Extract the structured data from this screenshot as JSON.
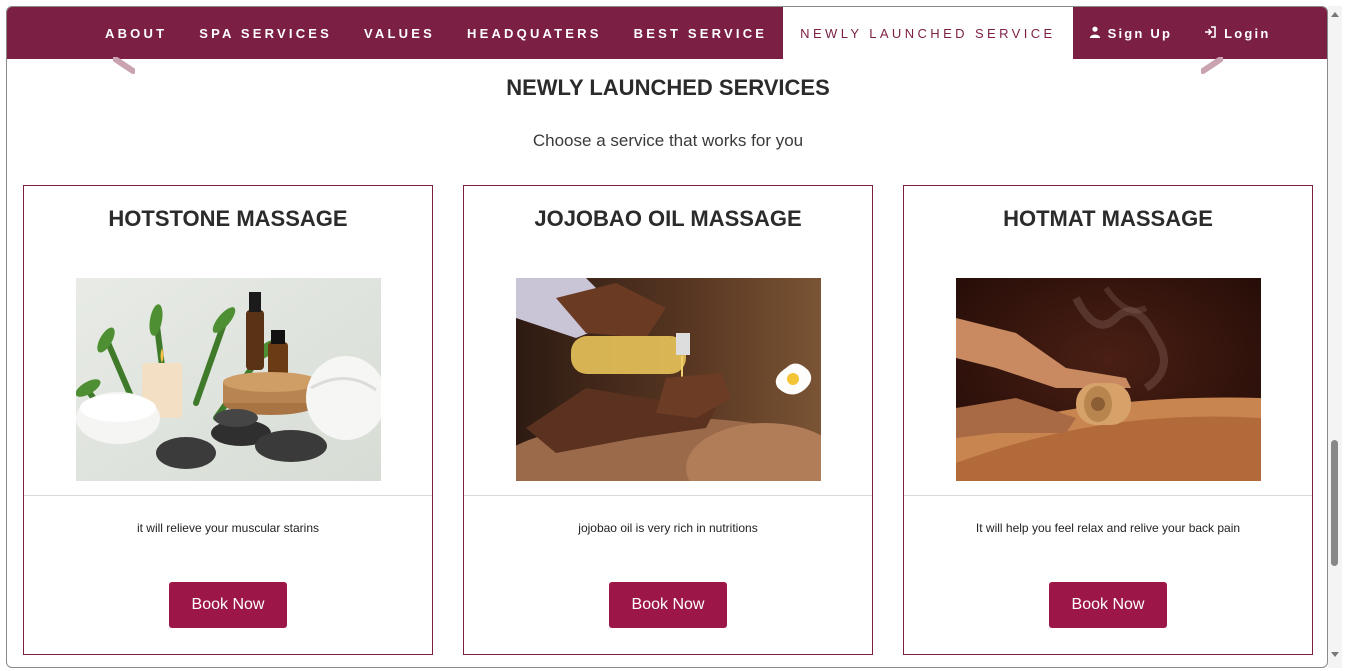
{
  "nav": {
    "items": [
      "ABOUT",
      "SPA SERVICES",
      "VALUES",
      "HEADQUATERS",
      "BEST SERVICE",
      "NEWLY LAUNCHED SERVICE"
    ],
    "signup": "Sign Up",
    "login": "Login",
    "signup_icon": "user-icon",
    "login_icon": "login-icon"
  },
  "section": {
    "title": "NEWLY LAUNCHED SERVICES",
    "subtitle": "Choose a service that works for you"
  },
  "cards": [
    {
      "title": "HOTSTONE MASSAGE",
      "desc": "it will relieve your muscular starins",
      "button": "Book Now"
    },
    {
      "title": "JOJOBAO OIL MASSAGE",
      "desc": "jojobao oil is very rich in nutritions",
      "button": "Book Now"
    },
    {
      "title": "HOTMAT MASSAGE",
      "desc": "It will help you feel relax and relive your back pain",
      "button": "Book Now"
    }
  ],
  "colors": {
    "brand": "#7b1f45",
    "button": "#9c1748"
  }
}
